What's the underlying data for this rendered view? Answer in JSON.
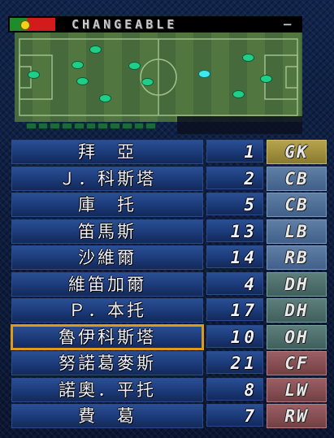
{
  "header": {
    "title": "CHANGEABLE",
    "dash": "−",
    "flag_colors": {
      "left": "#1f8c2c",
      "right": "#d41b1b"
    }
  },
  "formation_dot_color": "#1fcf88",
  "selected_dot_color": "#40e9e9",
  "players": [
    {
      "name": "拜　亞",
      "number": "1",
      "position": "GK",
      "group": "gk"
    },
    {
      "name": "Ｊ．科斯塔",
      "number": "2",
      "position": "CB",
      "group": "def"
    },
    {
      "name": "庫　托",
      "number": "5",
      "position": "CB",
      "group": "def"
    },
    {
      "name": "笛馬斯",
      "number": "13",
      "position": "LB",
      "group": "def"
    },
    {
      "name": "沙維爾",
      "number": "14",
      "position": "RB",
      "group": "def"
    },
    {
      "name": "維笛加爾",
      "number": "4",
      "position": "DH",
      "group": "mid"
    },
    {
      "name": "Ｐ．本托",
      "number": "17",
      "position": "DH",
      "group": "mid"
    },
    {
      "name": "魯伊科斯塔",
      "number": "10",
      "position": "OH",
      "group": "mid",
      "selected": true
    },
    {
      "name": "努諾葛麥斯",
      "number": "21",
      "position": "CF",
      "group": "fwd"
    },
    {
      "name": "諾奧．平托",
      "number": "8",
      "position": "LW",
      "group": "fwd"
    },
    {
      "name": "費　葛",
      "number": "7",
      "position": "RW",
      "group": "fwd"
    }
  ]
}
